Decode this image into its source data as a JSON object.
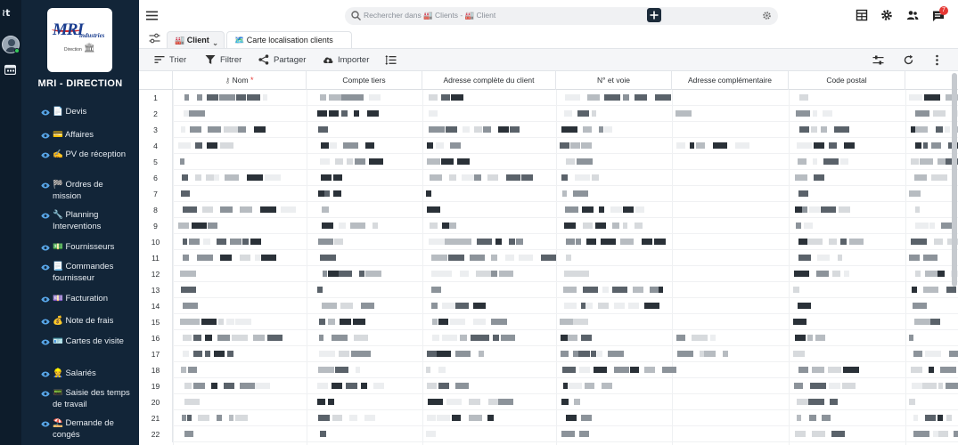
{
  "sidebar": {
    "title": "MRI - DIRECTION",
    "logo_text": "MRI",
    "logo_sub": "industries",
    "logo_caption": "Direction",
    "items": [
      {
        "label": "📄 Devis"
      },
      {
        "label": "💳 Affaires"
      },
      {
        "label": "✍️ PV de réception"
      },
      {
        "label": "🏁 Ordres de mission"
      },
      {
        "label": "🔧 Planning Interventions"
      },
      {
        "label": "💵 Fournisseurs"
      },
      {
        "label": "📃 Commandes fournisseur"
      },
      {
        "label": "💷 Facturation"
      },
      {
        "label": "💰 Note de frais"
      },
      {
        "label": "🪪 Cartes de visite"
      },
      {
        "label": "👷 Salariés"
      },
      {
        "label": "📟 Saisie des temps de travail"
      },
      {
        "label": "⛱️ Demande de congés"
      }
    ]
  },
  "topbar": {
    "search_placeholder": "Rechercher dans 🏭 Clients - 🏭 Client",
    "notification_count": "7"
  },
  "views": {
    "tabs": [
      {
        "label": "🏭 Client",
        "active": true
      },
      {
        "label": "🗺️ Carte localisation clients",
        "active": false
      }
    ]
  },
  "toolbar": {
    "sort_label": "Trier",
    "filter_label": "Filtrer",
    "share_label": "Partager",
    "import_label": "Importer"
  },
  "grid": {
    "columns": [
      "Nom",
      "Compte tiers",
      "Adresse complète du client",
      "N° et voie",
      "Adresse complémentaire",
      "Code postal"
    ],
    "row_numbers": [
      "1",
      "2",
      "3",
      "4",
      "5",
      "6",
      "7",
      "8",
      "9",
      "10",
      "11",
      "12",
      "13",
      "14",
      "15",
      "16",
      "17",
      "18",
      "19",
      "20",
      "21",
      "22"
    ],
    "cell_content": "masked"
  }
}
